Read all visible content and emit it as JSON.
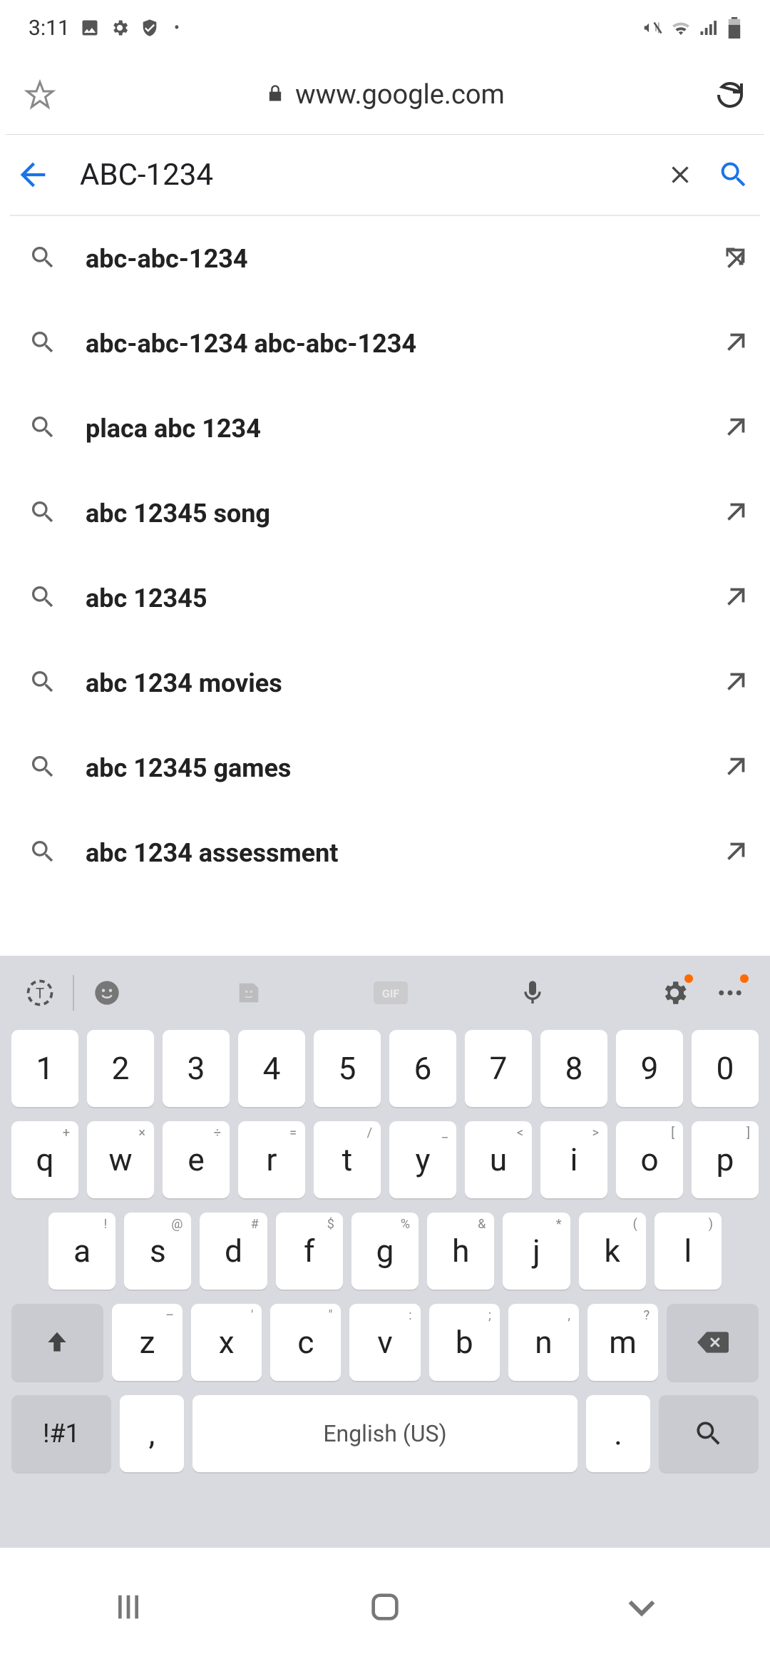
{
  "status": {
    "time": "3:11"
  },
  "browser": {
    "url": "www.google.com"
  },
  "search": {
    "query": "ABC-1234"
  },
  "suggestions": [
    {
      "text": "abc-abc-1234"
    },
    {
      "text": "abc-abc-1234 abc-abc-1234"
    },
    {
      "text": "placa abc 1234"
    },
    {
      "text": "abc 12345 song"
    },
    {
      "text": "abc 12345"
    },
    {
      "text": "abc 1234 movies"
    },
    {
      "text": "abc 12345 games"
    },
    {
      "text": "abc 1234 assessment"
    }
  ],
  "keyboard": {
    "row_num": [
      "1",
      "2",
      "3",
      "4",
      "5",
      "6",
      "7",
      "8",
      "9",
      "0"
    ],
    "row_q": [
      {
        "k": "q",
        "h": "+"
      },
      {
        "k": "w",
        "h": "×"
      },
      {
        "k": "e",
        "h": "÷"
      },
      {
        "k": "r",
        "h": "="
      },
      {
        "k": "t",
        "h": "/"
      },
      {
        "k": "y",
        "h": "_"
      },
      {
        "k": "u",
        "h": "<"
      },
      {
        "k": "i",
        "h": ">"
      },
      {
        "k": "o",
        "h": "["
      },
      {
        "k": "p",
        "h": "]"
      }
    ],
    "row_a": [
      {
        "k": "a",
        "h": "!"
      },
      {
        "k": "s",
        "h": "@"
      },
      {
        "k": "d",
        "h": "#"
      },
      {
        "k": "f",
        "h": "$"
      },
      {
        "k": "g",
        "h": "%"
      },
      {
        "k": "h",
        "h": "&"
      },
      {
        "k": "j",
        "h": "*"
      },
      {
        "k": "k",
        "h": "("
      },
      {
        "k": "l",
        "h": ")"
      }
    ],
    "row_z": [
      {
        "k": "z",
        "h": "–"
      },
      {
        "k": "x",
        "h": "'"
      },
      {
        "k": "c",
        "h": "\""
      },
      {
        "k": "v",
        "h": ":"
      },
      {
        "k": "b",
        "h": ";"
      },
      {
        "k": "n",
        "h": ","
      },
      {
        "k": "m",
        "h": "?"
      }
    ],
    "sym_label": "!#1",
    "comma": ",",
    "space_label": "English (US)",
    "period": "."
  }
}
